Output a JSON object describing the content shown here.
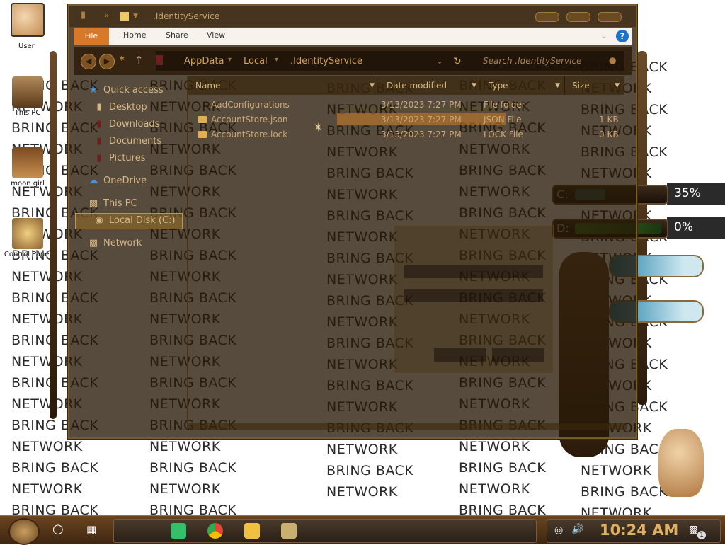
{
  "wallpaper": {
    "bring": "BRING BACK",
    "network": "NETWORK"
  },
  "desktop_icons": [
    {
      "label": "User"
    },
    {
      "label": "This PC"
    },
    {
      "label": "moon girl"
    },
    {
      "label": "Control Panel"
    }
  ],
  "explorer": {
    "title": ".IdentityService",
    "ribbon": {
      "file": "File",
      "home": "Home",
      "share": "Share",
      "view": "View",
      "help": "?"
    },
    "breadcrumbs": [
      "AppData",
      "Local",
      ".IdentityService"
    ],
    "search_placeholder": "Search .IdentityService",
    "nav": {
      "quick_access": "Quick access",
      "desktop": "Desktop",
      "downloads": "Downloads",
      "documents": "Documents",
      "pictures": "Pictures",
      "onedrive": "OneDrive",
      "this_pc": "This PC",
      "local_disk": "Local Disk (C:)",
      "network": "Network"
    },
    "columns": {
      "name": "Name",
      "date": "Date modified",
      "type": "Type",
      "size": "Size"
    },
    "files": [
      {
        "name": "AadConfigurations",
        "date": "3/13/2023 7:27 PM",
        "type": "File folder",
        "size": ""
      },
      {
        "name": "AccountStore.json",
        "date": "3/13/2023 7:27 PM",
        "type": "JSON File",
        "size": "1 KB"
      },
      {
        "name": "AccountStore.lock",
        "date": "3/13/2023 7:27 PM",
        "type": "LOCK File",
        "size": "0 KB"
      }
    ]
  },
  "drives": [
    {
      "letter": "C:",
      "percent": "35%",
      "fill": 0.35,
      "color": "#2e5e52"
    },
    {
      "letter": "D:",
      "percent": "0%",
      "fill": 0.0,
      "color": "#3a8a2a"
    }
  ],
  "taskbar": {
    "clock": "10:24 AM",
    "notification_count": "1"
  }
}
